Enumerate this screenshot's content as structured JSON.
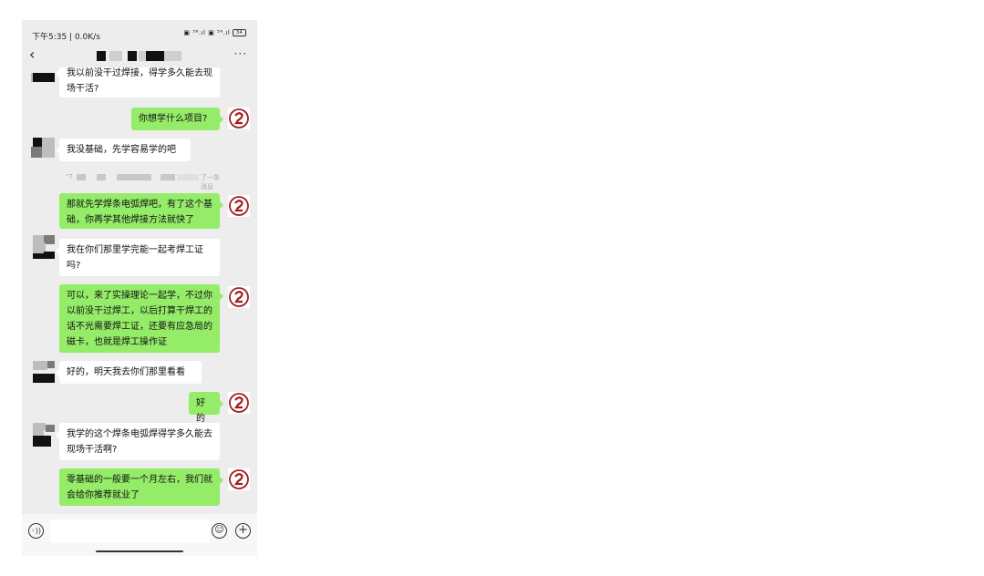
{
  "status_bar": {
    "time": "下午5:35 | 0.0K/s",
    "signal_icons": "▣ ⁵⁶.ıl ▣ ⁵⁶.ıl",
    "battery": "34"
  },
  "navbar": {
    "back_icon": "‹",
    "more_icon": "···"
  },
  "messages": [
    {
      "side": "left",
      "text": "我以前没干过焊接，得学多久能去现场干活?"
    },
    {
      "side": "right",
      "text": "你想学什么项目?"
    },
    {
      "side": "left",
      "text": "我没基础，先学容易学的吧"
    },
    {
      "side": "right",
      "text": "那就先学焊条电弧焊吧，有了这个基础，你再学其他焊接方法就快了"
    },
    {
      "side": "left",
      "text": "我在你们那里学完能一起考焊工证吗?"
    },
    {
      "side": "right",
      "text": "可以，来了实操理论一起学，不过你以前没干过焊工，以后打算干焊工的话不光需要焊工证，还要有应急局的磁卡，也就是焊工操作证"
    },
    {
      "side": "left",
      "text": "好的，明天我去你们那里看看"
    },
    {
      "side": "right",
      "text": "好的"
    },
    {
      "side": "left",
      "text": "我学的这个焊条电弧焊得学多久能去现场干活啊?"
    },
    {
      "side": "right",
      "text": "零基础的一般要一个月左右，我们就会给你推荐就业了"
    }
  ],
  "recall_notice": {
    "prefix": "\"7",
    "suffix": "了一条消息"
  },
  "input_bar": {
    "voice_icon": "◦))",
    "emoji_icon": "☺",
    "plus_icon": "+"
  },
  "colors": {
    "chat_bg": "#ededed",
    "right_bubble": "#95ec69",
    "left_bubble": "#ffffff",
    "logo_red": "#a11d21"
  }
}
